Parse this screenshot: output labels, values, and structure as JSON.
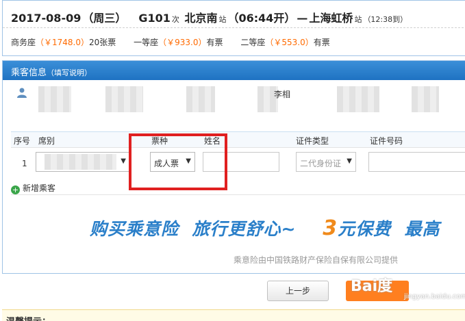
{
  "train": {
    "date": "2017-08-09",
    "weekday": "（周三）",
    "number": "G101",
    "ci": "次",
    "from": "北京南",
    "from_zhan": "站",
    "depart": "（06:44开）",
    "dash": "—",
    "to": "上海虹桥",
    "to_zhan": "站",
    "arrive": "（12:38到）"
  },
  "seats": [
    {
      "name": "商务座",
      "price": "（￥1748.0）",
      "avail": "20张票"
    },
    {
      "name": "一等座",
      "price": "（￥933.0）",
      "avail": "有票"
    },
    {
      "name": "二等座",
      "price": "（￥553.0）",
      "avail": "有票"
    }
  ],
  "passenger": {
    "title": "乘客信息",
    "title_sub": "（填写说明）",
    "col_headers": [
      "序号",
      "席别",
      "票种",
      "姓名",
      "证件类型",
      "证件号码"
    ],
    "row_num": "1",
    "ticket_type": "成人票",
    "id_type": "二代身份证",
    "add_label": "新增乘客",
    "checkbox_label": "李相"
  },
  "insurance": {
    "slogan_a": "购买乘意险",
    "slogan_b": "旅行更舒心~",
    "price_num": "3",
    "price_text": "元保费",
    "slogan_c": "最高",
    "provider": "乘意险由中国铁路财产保险自保有限公司提供"
  },
  "buttons": {
    "prev": "上一步"
  },
  "watermark": {
    "text": "Bai度",
    "sub": "jingyan.baidu.com"
  },
  "tip": "温馨提示：",
  "colors": {
    "accent": "#1f72c2",
    "price": "#ff6a00",
    "highlight": "#e02020",
    "submit": "#ff7f1f"
  }
}
